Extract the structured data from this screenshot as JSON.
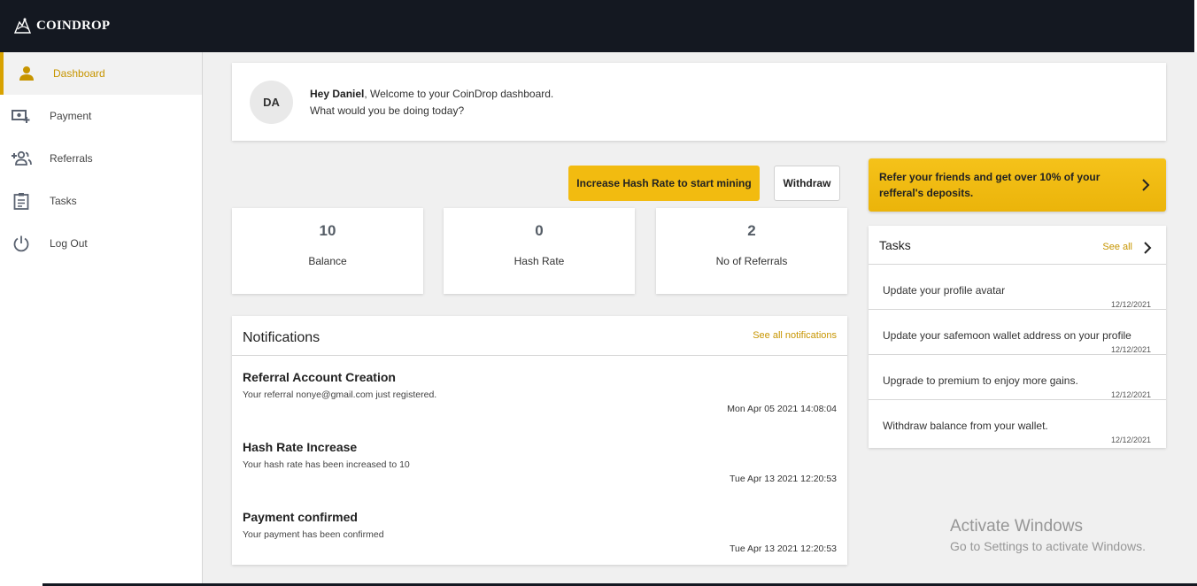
{
  "header": {
    "brand": "COINDROP"
  },
  "sidebar": {
    "items": [
      {
        "label": "Dashboard",
        "icon": "person-icon",
        "active": true
      },
      {
        "label": "Payment",
        "icon": "payment-add-icon"
      },
      {
        "label": "Referrals",
        "icon": "add-group-icon"
      },
      {
        "label": "Tasks",
        "icon": "clipboard-icon"
      },
      {
        "label": "Log Out",
        "icon": "power-icon"
      }
    ]
  },
  "welcome": {
    "initials": "DA",
    "greeting": "Hey Daniel",
    "message": ", Welcome to your CoinDrop dashboard.",
    "question": "What would you be doing today?"
  },
  "actions": {
    "increase_hash": "Increase Hash Rate to start mining",
    "withdraw": "Withdraw"
  },
  "stats": [
    {
      "value": "10",
      "label": "Balance"
    },
    {
      "value": "0",
      "label": "Hash Rate"
    },
    {
      "value": "2",
      "label": "No of Referrals"
    }
  ],
  "notifications": {
    "title": "Notifications",
    "see_all": "See all notifications",
    "items": [
      {
        "title": "Referral Account Creation",
        "body": "Your referral nonye@gmail.com just registered.",
        "time": "Mon Apr 05 2021 14:08:04"
      },
      {
        "title": "Hash Rate Increase",
        "body": "Your hash rate has been increased to 10",
        "time": "Tue Apr 13 2021 12:20:53"
      },
      {
        "title": "Payment confirmed",
        "body": "Your payment has been confirmed",
        "time": "Tue Apr 13 2021 12:20:53"
      }
    ]
  },
  "refer": {
    "text": "Refer your friends and get over 10% of your refferal's deposits."
  },
  "tasks": {
    "title": "Tasks",
    "see_all": "See all",
    "items": [
      {
        "text": "Update your profile avatar",
        "date": "12/12/2021"
      },
      {
        "text": "Update your safemoon wallet address on your profile",
        "date": "12/12/2021"
      },
      {
        "text": "Upgrade to premium to enjoy more gains.",
        "date": "12/12/2021"
      },
      {
        "text": "Withdraw balance from your wallet.",
        "date": "12/12/2021"
      }
    ]
  },
  "watermark": {
    "line1": "Activate Windows",
    "line2": "Go to Settings to activate Windows."
  },
  "colors": {
    "accent": "#f2bb10",
    "accent_text": "#c79500",
    "topbar": "#141821"
  }
}
